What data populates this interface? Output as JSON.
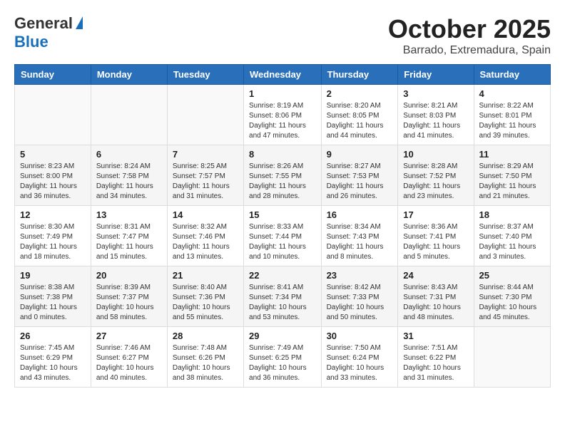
{
  "header": {
    "logo_general": "General",
    "logo_blue": "Blue",
    "month_title": "October 2025",
    "subtitle": "Barrado, Extremadura, Spain"
  },
  "days_of_week": [
    "Sunday",
    "Monday",
    "Tuesday",
    "Wednesday",
    "Thursday",
    "Friday",
    "Saturday"
  ],
  "weeks": [
    [
      {
        "day": "",
        "info": ""
      },
      {
        "day": "",
        "info": ""
      },
      {
        "day": "",
        "info": ""
      },
      {
        "day": "1",
        "info": "Sunrise: 8:19 AM\nSunset: 8:06 PM\nDaylight: 11 hours\nand 47 minutes."
      },
      {
        "day": "2",
        "info": "Sunrise: 8:20 AM\nSunset: 8:05 PM\nDaylight: 11 hours\nand 44 minutes."
      },
      {
        "day": "3",
        "info": "Sunrise: 8:21 AM\nSunset: 8:03 PM\nDaylight: 11 hours\nand 41 minutes."
      },
      {
        "day": "4",
        "info": "Sunrise: 8:22 AM\nSunset: 8:01 PM\nDaylight: 11 hours\nand 39 minutes."
      }
    ],
    [
      {
        "day": "5",
        "info": "Sunrise: 8:23 AM\nSunset: 8:00 PM\nDaylight: 11 hours\nand 36 minutes."
      },
      {
        "day": "6",
        "info": "Sunrise: 8:24 AM\nSunset: 7:58 PM\nDaylight: 11 hours\nand 34 minutes."
      },
      {
        "day": "7",
        "info": "Sunrise: 8:25 AM\nSunset: 7:57 PM\nDaylight: 11 hours\nand 31 minutes."
      },
      {
        "day": "8",
        "info": "Sunrise: 8:26 AM\nSunset: 7:55 PM\nDaylight: 11 hours\nand 28 minutes."
      },
      {
        "day": "9",
        "info": "Sunrise: 8:27 AM\nSunset: 7:53 PM\nDaylight: 11 hours\nand 26 minutes."
      },
      {
        "day": "10",
        "info": "Sunrise: 8:28 AM\nSunset: 7:52 PM\nDaylight: 11 hours\nand 23 minutes."
      },
      {
        "day": "11",
        "info": "Sunrise: 8:29 AM\nSunset: 7:50 PM\nDaylight: 11 hours\nand 21 minutes."
      }
    ],
    [
      {
        "day": "12",
        "info": "Sunrise: 8:30 AM\nSunset: 7:49 PM\nDaylight: 11 hours\nand 18 minutes."
      },
      {
        "day": "13",
        "info": "Sunrise: 8:31 AM\nSunset: 7:47 PM\nDaylight: 11 hours\nand 15 minutes."
      },
      {
        "day": "14",
        "info": "Sunrise: 8:32 AM\nSunset: 7:46 PM\nDaylight: 11 hours\nand 13 minutes."
      },
      {
        "day": "15",
        "info": "Sunrise: 8:33 AM\nSunset: 7:44 PM\nDaylight: 11 hours\nand 10 minutes."
      },
      {
        "day": "16",
        "info": "Sunrise: 8:34 AM\nSunset: 7:43 PM\nDaylight: 11 hours\nand 8 minutes."
      },
      {
        "day": "17",
        "info": "Sunrise: 8:36 AM\nSunset: 7:41 PM\nDaylight: 11 hours\nand 5 minutes."
      },
      {
        "day": "18",
        "info": "Sunrise: 8:37 AM\nSunset: 7:40 PM\nDaylight: 11 hours\nand 3 minutes."
      }
    ],
    [
      {
        "day": "19",
        "info": "Sunrise: 8:38 AM\nSunset: 7:38 PM\nDaylight: 11 hours\nand 0 minutes."
      },
      {
        "day": "20",
        "info": "Sunrise: 8:39 AM\nSunset: 7:37 PM\nDaylight: 10 hours\nand 58 minutes."
      },
      {
        "day": "21",
        "info": "Sunrise: 8:40 AM\nSunset: 7:36 PM\nDaylight: 10 hours\nand 55 minutes."
      },
      {
        "day": "22",
        "info": "Sunrise: 8:41 AM\nSunset: 7:34 PM\nDaylight: 10 hours\nand 53 minutes."
      },
      {
        "day": "23",
        "info": "Sunrise: 8:42 AM\nSunset: 7:33 PM\nDaylight: 10 hours\nand 50 minutes."
      },
      {
        "day": "24",
        "info": "Sunrise: 8:43 AM\nSunset: 7:31 PM\nDaylight: 10 hours\nand 48 minutes."
      },
      {
        "day": "25",
        "info": "Sunrise: 8:44 AM\nSunset: 7:30 PM\nDaylight: 10 hours\nand 45 minutes."
      }
    ],
    [
      {
        "day": "26",
        "info": "Sunrise: 7:45 AM\nSunset: 6:29 PM\nDaylight: 10 hours\nand 43 minutes."
      },
      {
        "day": "27",
        "info": "Sunrise: 7:46 AM\nSunset: 6:27 PM\nDaylight: 10 hours\nand 40 minutes."
      },
      {
        "day": "28",
        "info": "Sunrise: 7:48 AM\nSunset: 6:26 PM\nDaylight: 10 hours\nand 38 minutes."
      },
      {
        "day": "29",
        "info": "Sunrise: 7:49 AM\nSunset: 6:25 PM\nDaylight: 10 hours\nand 36 minutes."
      },
      {
        "day": "30",
        "info": "Sunrise: 7:50 AM\nSunset: 6:24 PM\nDaylight: 10 hours\nand 33 minutes."
      },
      {
        "day": "31",
        "info": "Sunrise: 7:51 AM\nSunset: 6:22 PM\nDaylight: 10 hours\nand 31 minutes."
      },
      {
        "day": "",
        "info": ""
      }
    ]
  ]
}
